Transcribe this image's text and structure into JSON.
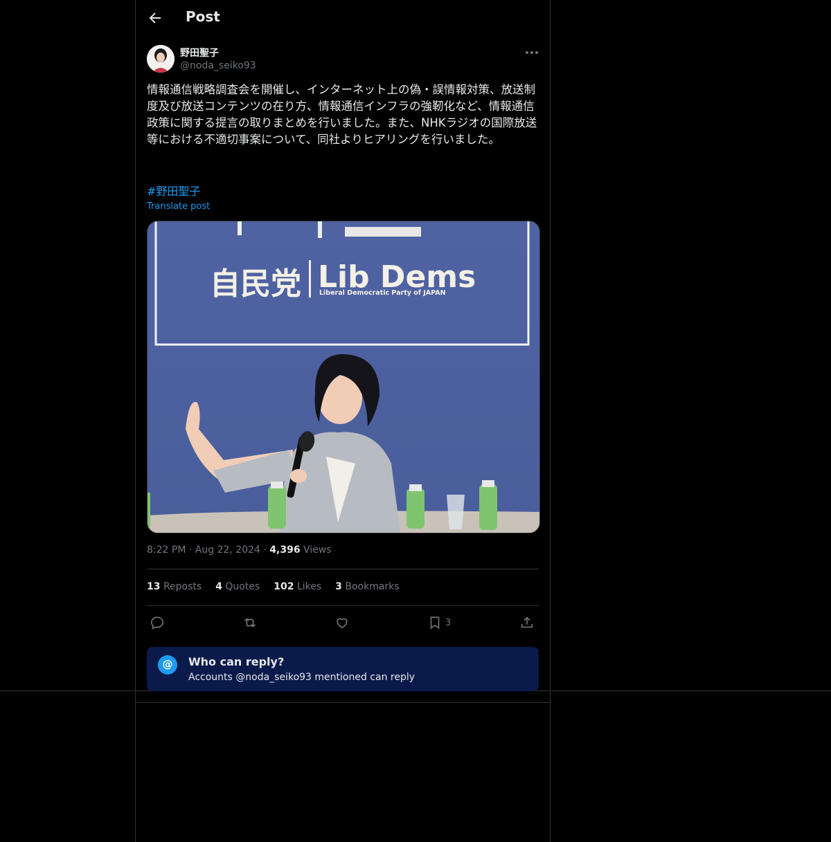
{
  "header": {
    "title": "Post"
  },
  "post": {
    "author_name": "野田聖子",
    "author_handle": "@noda_seiko93",
    "text": "情報通信戦略調査会を開催し、インターネット上の偽・誤情報対策、放送制度及び放送コンテンツの在り方、情報通信インフラの強靭化など、情報通信政策に関する提言の取りまとめを行いました。また、NHKラジオの国際放送等における不適切事案について、同社よりヒアリングを行いました。",
    "hashtag": "#野田聖子",
    "translate_label": "Translate post",
    "media": {
      "banner_jp": "自民党",
      "banner_en": "Lib Dems",
      "banner_sub": "Liberal Democratic Party of JAPAN"
    },
    "time": "8:22 PM",
    "date": "Aug 22, 2024",
    "views_count": "4,396",
    "views_label": "Views",
    "stats": {
      "reposts_count": "13",
      "reposts_label": "Reposts",
      "quotes_count": "4",
      "quotes_label": "Quotes",
      "likes_count": "102",
      "likes_label": "Likes",
      "bookmarks_count": "3",
      "bookmarks_label": "Bookmarks"
    },
    "actions": {
      "bookmark_count": "3"
    }
  },
  "reply_restriction": {
    "icon": "@",
    "title": "Who can reply?",
    "subtitle": "Accounts @noda_seiko93 mentioned can reply"
  },
  "colors": {
    "accent": "#1d9bf0",
    "background": "#000000",
    "muted": "#71767b",
    "reply_box": "#0a1a4a"
  }
}
